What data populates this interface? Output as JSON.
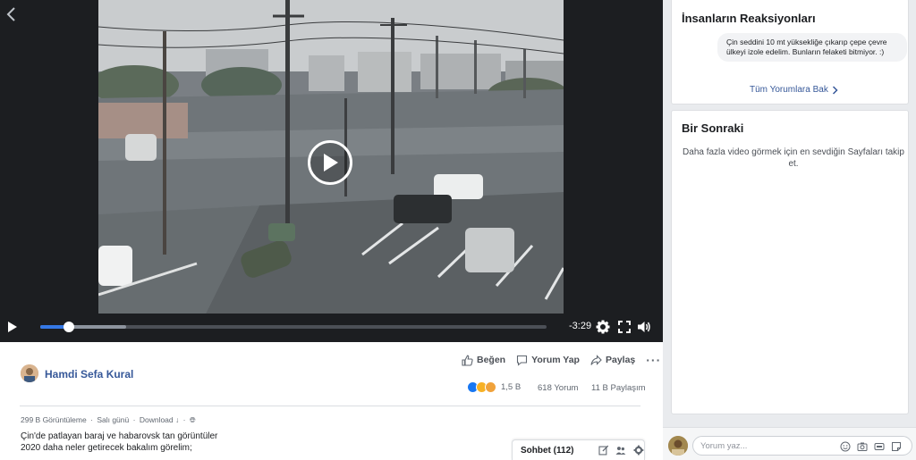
{
  "video": {
    "time_remaining": "-3:29",
    "progress_fraction": 0.057,
    "buffered_fraction": 0.17
  },
  "post": {
    "author": "Hamdi Sefa Kural",
    "actions": {
      "like": "Beğen",
      "comment": "Yorum Yap",
      "share": "Paylaş"
    },
    "reaction_count": "1,5 B",
    "comments_count": "618 Yorum",
    "shares_count": "11 B Paylaşım",
    "views": "299 B Görüntüleme",
    "meta_sep": "·",
    "date": "Salı günü",
    "download": "Download ↓",
    "caption_line1": "Çin'de patlayan baraj ve habarovsk tan görüntüler",
    "caption_line2": "2020 daha neler getirecek bakalım görelim;"
  },
  "chat": {
    "label": "Sohbet (112)"
  },
  "reactions_panel": {
    "title": "İnsanların Reaksiyonları",
    "comment_text": "Çin seddini 10 mt yüksekliğe çıkarıp çepe çevre ülkeyi izole edelim. Bunların felaketi bitmiyor. :)",
    "see_all": "Tüm Yorumlara Bak"
  },
  "next_panel": {
    "title": "Bir Sonraki",
    "description": "Daha fazla video görmek için en sevdiğin Sayfaları takip et."
  },
  "comment_box": {
    "placeholder": "Yorum yaz..."
  },
  "colors": {
    "link": "#365899",
    "progress": "#3578e5",
    "player_bg": "#1c1e21"
  }
}
